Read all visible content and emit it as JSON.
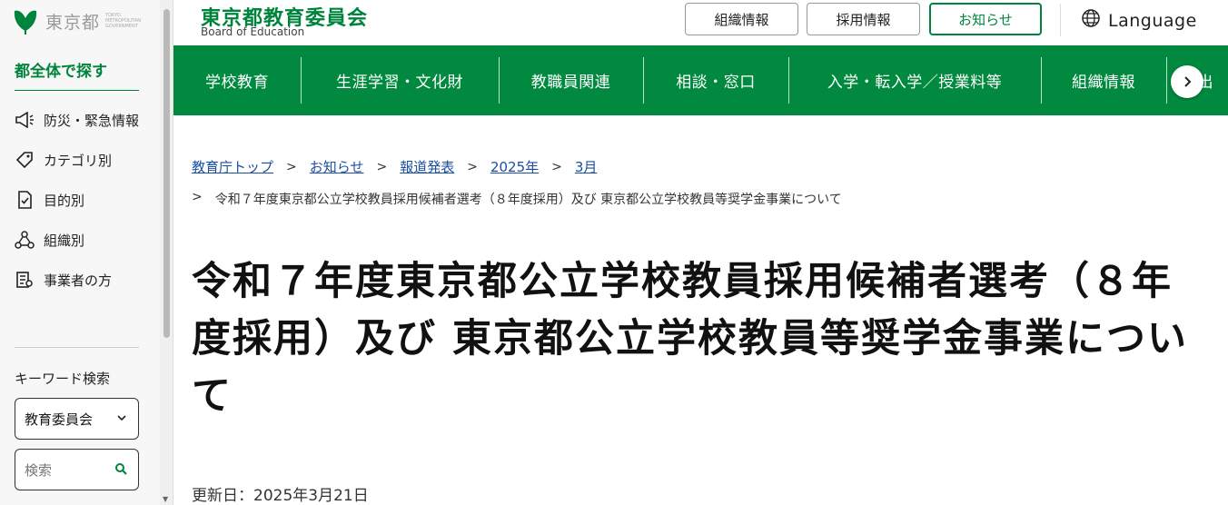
{
  "sidebar": {
    "logo_text": "東京都",
    "logo_small": "TOKYO METROPOLITAN GOVERNMENT",
    "heading": "都全体で探す",
    "items": [
      {
        "label": "防災・緊急情報",
        "icon": "megaphone-icon"
      },
      {
        "label": "カテゴリ別",
        "icon": "tag-icon"
      },
      {
        "label": "目的別",
        "icon": "checklist-icon"
      },
      {
        "label": "組織別",
        "icon": "org-chart-icon"
      },
      {
        "label": "事業者の方",
        "icon": "business-icon"
      }
    ],
    "keyword_label": "キーワード検索",
    "keyword_select": "教育委員会",
    "search_placeholder": "検索"
  },
  "header": {
    "title": "東京都教育委員会",
    "subtitle": "Board of Education",
    "buttons": [
      "組織情報",
      "採用情報",
      "お知らせ"
    ],
    "language": "Language"
  },
  "nav": {
    "items": [
      "学校教育",
      "生涯学習・文化財",
      "教職員関連",
      "相談・窓口",
      "入学・転入学／授業料等",
      "組織情報",
      "届出"
    ]
  },
  "breadcrumb": {
    "links": [
      "教育庁トップ",
      "お知らせ",
      "報道発表",
      "2025年",
      "3月"
    ],
    "current": "令和７年度東京都公立学校教員採用候補者選考（８年度採用）及び 東京都公立学校教員等奨学金事業について"
  },
  "page": {
    "title": "令和７年度東京都公立学校教員採用候補者選考（８年度採用）及び 東京都公立学校教員等奨学金事業について",
    "updated": "更新日：2025年3月21日"
  },
  "colors": {
    "brand_green": "#00843d",
    "link_blue": "#1a4fa0"
  }
}
